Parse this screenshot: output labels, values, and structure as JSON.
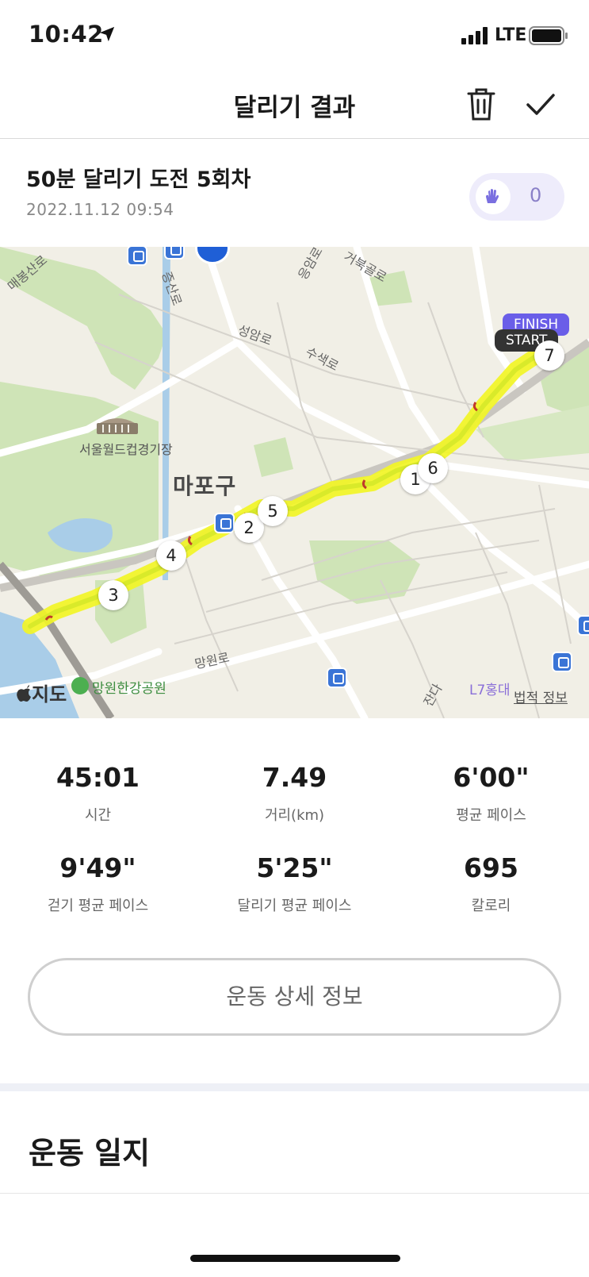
{
  "status_bar": {
    "time": "10:42",
    "network": "LTE"
  },
  "header": {
    "title": "달리기 결과"
  },
  "run": {
    "title": "50분 달리기 도전 5회차",
    "date": "2022.11.12 09:54",
    "clap_count": "0"
  },
  "map": {
    "district": "마포구",
    "stadium_label": "서울월드컵경기장",
    "park_label": "망원한강공원",
    "roads": [
      "매봉산로",
      "증산로",
      "성암로",
      "수색로",
      "응암로",
      "거북골로",
      "망원로",
      "잔다"
    ],
    "poi_label": "L7홍대",
    "brand": "지도",
    "legal": "법적 정보",
    "start_label": "START",
    "finish_label": "FINISH",
    "km_markers": [
      "1",
      "2",
      "3",
      "4",
      "5",
      "6",
      "7"
    ],
    "route_color": "#f2f526"
  },
  "stats": [
    {
      "value": "45:01",
      "label": "시간"
    },
    {
      "value": "7.49",
      "label": "거리(km)"
    },
    {
      "value": "6'00\"",
      "label": "평균 페이스"
    },
    {
      "value": "9'49\"",
      "label": "걷기 평균 페이스"
    },
    {
      "value": "5'25\"",
      "label": "달리기 평균 페이스"
    },
    {
      "value": "695",
      "label": "칼로리"
    }
  ],
  "detail_button": "운동 상세 정보",
  "log": {
    "title": "운동 일지"
  },
  "colors": {
    "accent": "#6a5ee8",
    "clap_bg": "#eeecfb"
  }
}
